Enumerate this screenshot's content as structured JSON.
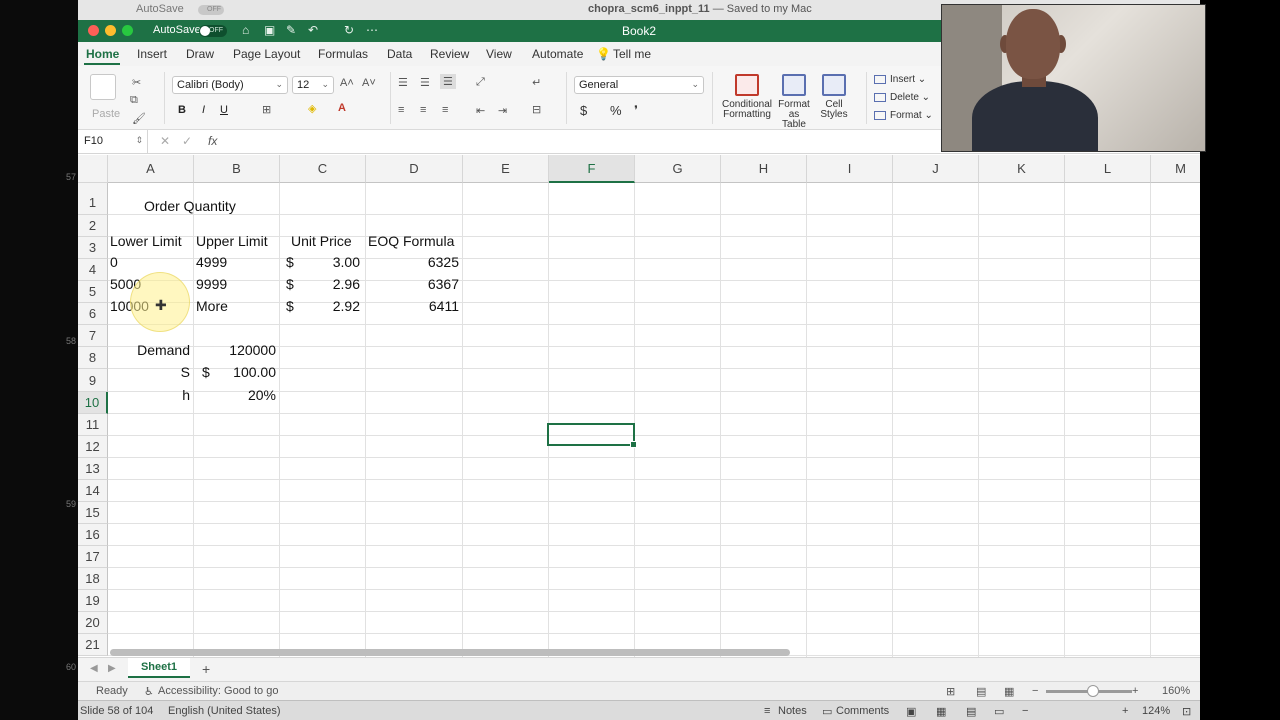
{
  "host": {
    "autosave_label": "AutoSave",
    "autosave_state": "OFF",
    "file_title": "chopra_scm6_inppt_11",
    "save_status": " — Saved to my Mac",
    "slide_info": "Slide 58 of 104",
    "language": "English (United States)",
    "notes_label": "Notes",
    "comments_label": "Comments",
    "zoom": "124%",
    "margin_numbers": [
      "57",
      "58",
      "59",
      "60"
    ]
  },
  "excel": {
    "autosave_label": "AutoSave",
    "autosave_state": "OFF",
    "book_title": "Book2",
    "tabs": [
      "Home",
      "Insert",
      "Draw",
      "Page Layout",
      "Formulas",
      "Data",
      "Review",
      "View",
      "Automate"
    ],
    "tell_me": "Tell me",
    "ribbon": {
      "paste": "Paste",
      "font_name": "Calibri (Body)",
      "font_size": "12",
      "number_format": "General",
      "bold": "B",
      "italic": "I",
      "underline": "U",
      "currency": "$",
      "percent": "%",
      "conditional_formatting": "Conditional Formatting",
      "format_as_table": "Format as Table",
      "cell_styles": "Cell Styles",
      "insert": "Insert",
      "delete": "Delete",
      "format": "Format"
    },
    "name_box": "F10",
    "fx": "fx",
    "columns": [
      "A",
      "B",
      "C",
      "D",
      "E",
      "F",
      "G",
      "H",
      "I",
      "J",
      "K",
      "L",
      "M"
    ],
    "rows": [
      "1",
      "2",
      "3",
      "4",
      "5",
      "6",
      "7",
      "8",
      "9",
      "10",
      "11",
      "12",
      "13",
      "14",
      "15",
      "16",
      "17",
      "18",
      "19",
      "20",
      "21"
    ],
    "cells": {
      "r1": {
        "title": "Order Quantity"
      },
      "r2": {
        "a": "Lower Limit",
        "b": "Upper Limit",
        "c": "Unit Price",
        "d": "EOQ Formula"
      },
      "r3": {
        "a": "0",
        "b": "4999",
        "c_sym": "$",
        "c_val": "3.00",
        "d": "6325"
      },
      "r4": {
        "a": "5000",
        "b": "9999",
        "c_sym": "$",
        "c_val": "2.96",
        "d": "6367"
      },
      "r5": {
        "a": "10000",
        "b": "More",
        "c_sym": "$",
        "c_val": "2.92",
        "d": "6411"
      },
      "r7": {
        "a": "Demand",
        "b": "120000"
      },
      "r8": {
        "a": "S",
        "b_sym": "$",
        "b_val": "100.00"
      },
      "r9": {
        "a": "h",
        "b": "20%"
      }
    },
    "sheet_tab": "Sheet1",
    "add_sheet": "+",
    "status_ready": "Ready",
    "status_accessibility": "Accessibility: Good to go",
    "zoom": "160%"
  }
}
